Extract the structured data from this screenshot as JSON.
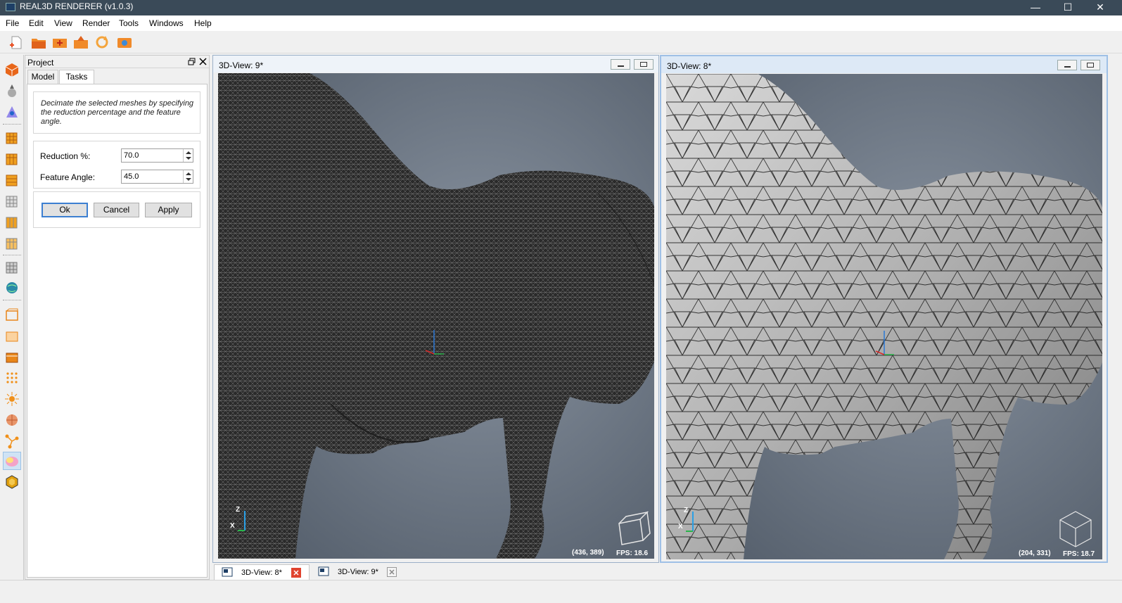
{
  "app": {
    "title": "REAL3D RENDERER (v1.0.3)"
  },
  "window_controls": {
    "minimize": "—",
    "maximize": "☐",
    "close": "✕"
  },
  "menu": [
    "File",
    "Edit",
    "View",
    "Render",
    "Tools",
    "Windows",
    "Help"
  ],
  "project_panel": {
    "title": "Project",
    "tabs": [
      {
        "label": "Model",
        "active": false
      },
      {
        "label": "Tasks",
        "active": true
      }
    ],
    "description": "Decimate the selected meshes by specifying the reduction percentage and the feature angle.",
    "fields": [
      {
        "label": "Reduction %:",
        "value": "70.0"
      },
      {
        "label": "Feature Angle:",
        "value": "45.0"
      }
    ],
    "buttons": {
      "ok": "Ok",
      "cancel": "Cancel",
      "apply": "Apply"
    }
  },
  "views": [
    {
      "title": "3D-View: 9*",
      "coords": "(436, 389)",
      "fps": "FPS: 18.6",
      "mesh": "dense-wireframe"
    },
    {
      "title": "3D-View: 8*",
      "coords": "(204, 331)",
      "fps": "FPS: 18.7",
      "mesh": "decimated-shaded"
    }
  ],
  "axis_labels": {
    "z": "Z",
    "x": "X"
  },
  "bottom_tabs": [
    {
      "label": "3D-View: 8*",
      "active": true
    },
    {
      "label": "3D-View: 9*",
      "active": false
    }
  ],
  "colors": {
    "titlebar": "#3a4a58",
    "accent": "#3c7fd1",
    "close_red": "#e0432f",
    "viewport_bg": "#5a6472"
  }
}
